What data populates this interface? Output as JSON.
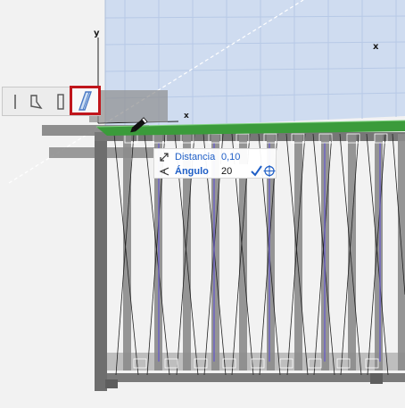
{
  "viewport": {
    "axes": {
      "y_top": "y",
      "x_top": "x",
      "x_small": "x"
    }
  },
  "toolbar": {
    "tools": [
      {
        "icon": "single-line-icon"
      },
      {
        "icon": "bent-shape-icon"
      },
      {
        "icon": "rectangle-shape-icon"
      },
      {
        "icon": "slanted-shape-icon",
        "selected": true
      }
    ]
  },
  "tracker": {
    "distance_label": "Distancia",
    "distance_value": "0,10",
    "angle_label": "Ángulo",
    "angle_value": "20"
  },
  "colors": {
    "selection_highlight": "#c0161c",
    "tracker_text": "#1f5fc7",
    "railing_top": "#3b9b3b",
    "grid_plane": "#c9d9ee"
  }
}
